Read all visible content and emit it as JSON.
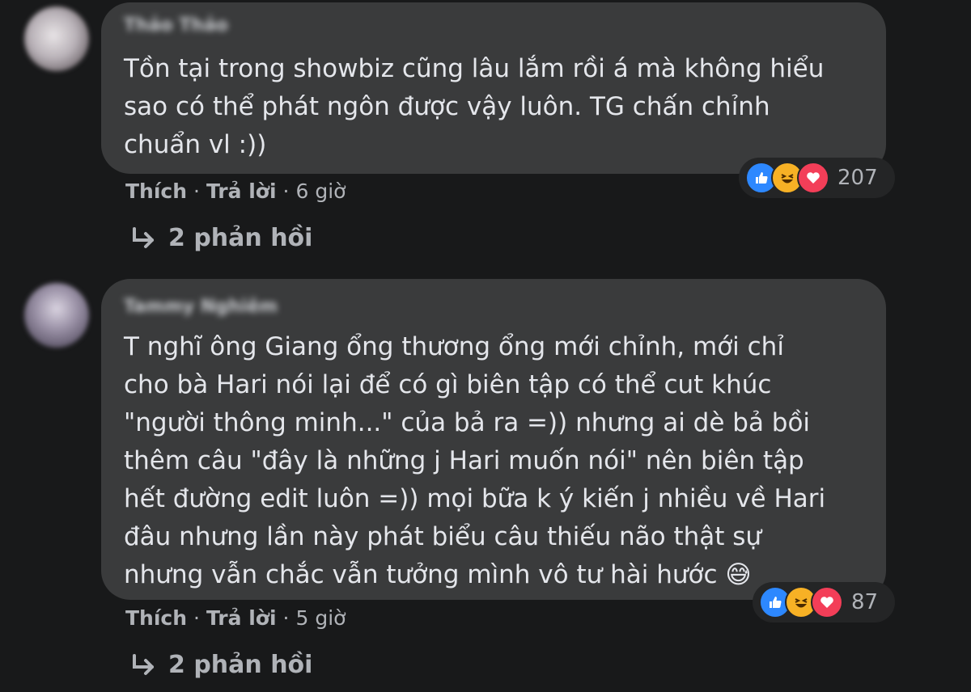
{
  "comments": [
    {
      "author": "Thảo Thảo",
      "text": "Tồn tại trong showbiz cũng lâu lắm rồi á mà không hiểu\nsao có thể phát ngôn được vậy luôn. TG chấn chỉnh\nchuẩn vl :))",
      "reaction_count": "207",
      "actions": {
        "like": "Thích",
        "reply": "Trả lời",
        "time": "6 giờ"
      },
      "replies_label": "2 phản hồi"
    },
    {
      "author": "Tammy Nghiêm",
      "text": "T nghĩ ông Giang ổng thương ổng mới chỉnh, mới chỉ\ncho bà Hari nói lại để có gì biên tập có thể cut khúc\n\"người thông minh...\" của bả ra =)) nhưng ai dè bả bồi\nthêm câu \"đây là những j Hari muốn nói\" nên biên tập\nhết đường edit luôn =)) mọi bữa k ý kiến j nhiều về Hari\nđâu nhưng lần này phát biểu câu thiếu não thật sự\nnhưng vẫn chắc vẫn tưởng mình vô tư hài hước 😅",
      "reaction_count": "87",
      "actions": {
        "like": "Thích",
        "reply": "Trả lời",
        "time": "5 giờ"
      },
      "replies_label": "2 phản hồi"
    }
  ],
  "reaction_icons": [
    "like-icon",
    "haha-icon",
    "love-icon"
  ],
  "colors": {
    "background": "#18191a",
    "bubble": "#3a3b3c",
    "text": "#e4e6eb",
    "secondary_text": "#b0b3b8",
    "like": "#2d88ff",
    "haha": "#f7b125",
    "love": "#f33e58"
  }
}
